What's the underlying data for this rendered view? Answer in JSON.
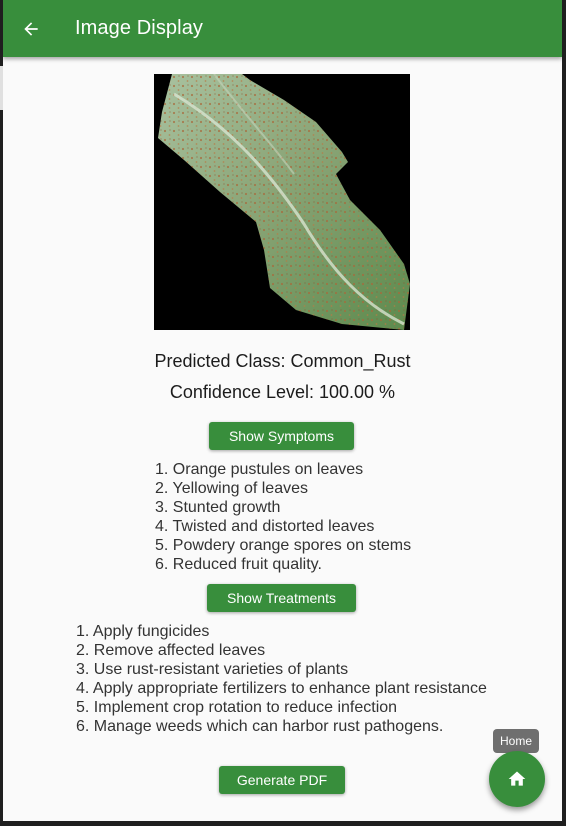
{
  "appbar": {
    "title": "Image Display",
    "back_icon": "arrow-back-icon"
  },
  "prediction": {
    "class_text": "Predicted Class: Common_Rust",
    "confidence_text": "Confidence Level: 100.00 %"
  },
  "symptoms": {
    "button_label": "Show Symptoms",
    "items": [
      "1. Orange pustules on leaves",
      "2. Yellowing of leaves",
      "3. Stunted growth",
      "4. Twisted and distorted leaves",
      "5. Powdery orange spores on stems",
      "6. Reduced fruit quality."
    ]
  },
  "treatments": {
    "button_label": "Show Treatments",
    "items": [
      "1. Apply fungicides",
      "2. Remove affected leaves",
      "3. Use rust-resistant varieties of plants",
      "4. Apply appropriate fertilizers to enhance plant resistance",
      "5. Implement crop rotation to reduce infection",
      "6. Manage weeds which can harbor rust pathogens."
    ]
  },
  "pdf_button_label": "Generate PDF",
  "home": {
    "tooltip": "Home",
    "icon": "home-icon"
  },
  "colors": {
    "primary": "#388e3c",
    "background": "#fafafa"
  }
}
